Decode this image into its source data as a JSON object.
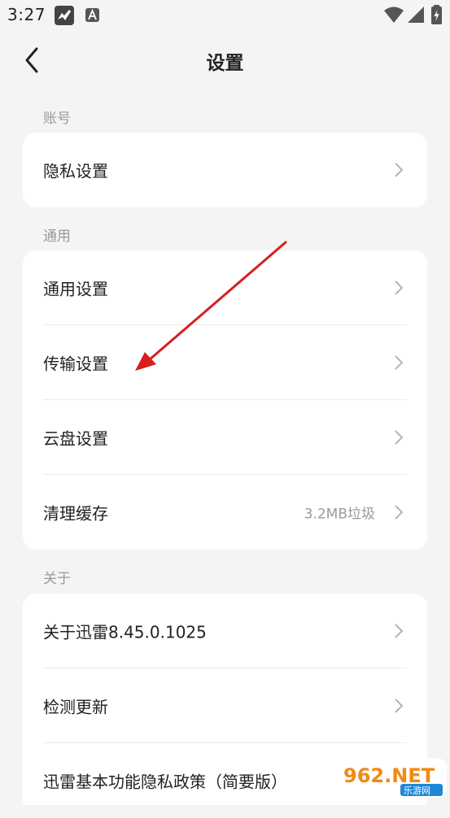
{
  "status_bar": {
    "time": "3:27",
    "icons": [
      "bird-app-icon",
      "a-notification-icon",
      "wifi-icon",
      "signal-icon",
      "battery-charging-icon"
    ]
  },
  "header": {
    "title": "设置",
    "back_icon": "chevron-left-icon"
  },
  "sections": [
    {
      "title": "账号",
      "items": [
        {
          "label": "隐私设置"
        }
      ]
    },
    {
      "title": "通用",
      "items": [
        {
          "label": "通用设置"
        },
        {
          "label": "传输设置"
        },
        {
          "label": "云盘设置"
        },
        {
          "label": "清理缓存",
          "value": "3.2MB垃圾"
        }
      ]
    },
    {
      "title": "关于",
      "items": [
        {
          "label": "关于迅雷8.45.0.1025"
        },
        {
          "label": "检测更新"
        },
        {
          "label": "迅雷基本功能隐私政策（简要版）"
        }
      ]
    }
  ],
  "annotation": {
    "color": "#d81e1e"
  },
  "watermark": {
    "brand": "962.NET",
    "sub": "乐游网"
  },
  "colors": {
    "background": "#f4f4f4",
    "card": "#ffffff",
    "secondary_text": "#9a9a9a"
  }
}
